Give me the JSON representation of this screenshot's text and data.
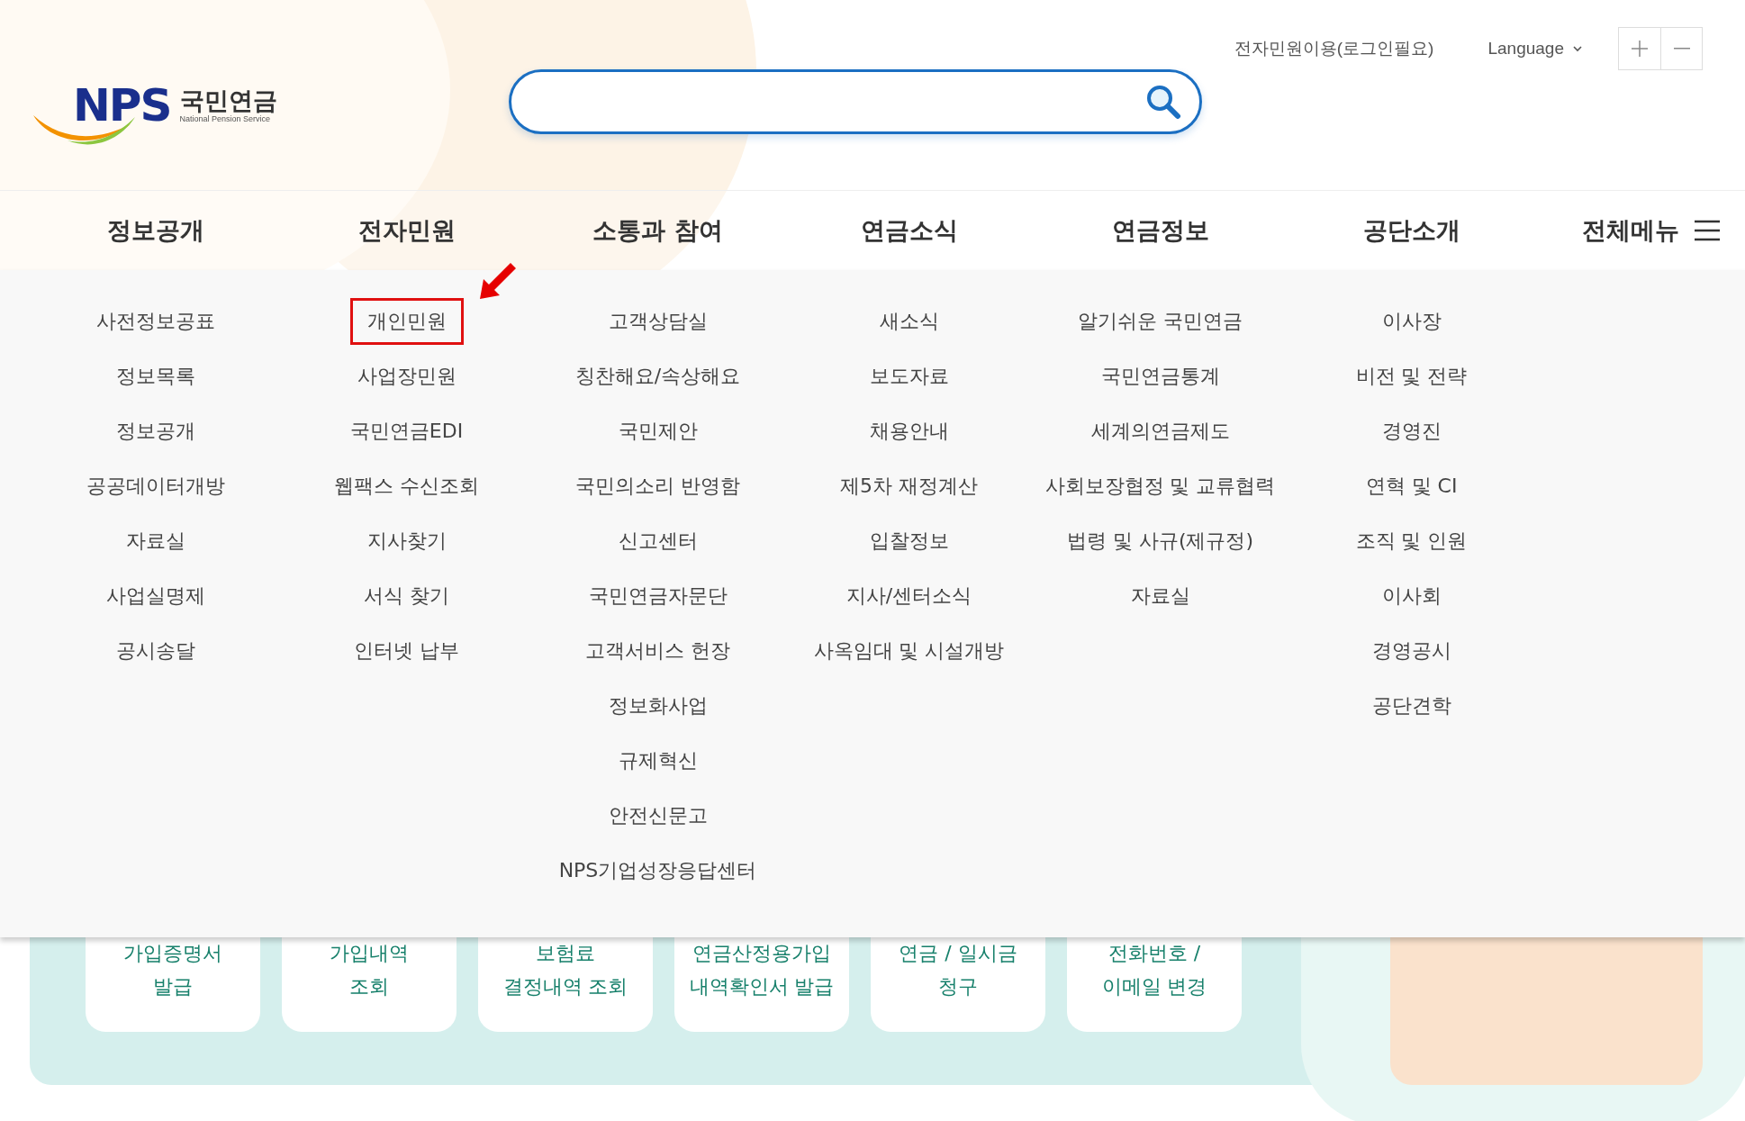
{
  "header": {
    "logo": {
      "mark": "NPS",
      "name": "국민연금",
      "subtitle": "National Pension Service"
    },
    "login_link": "전자민원이용(로그인필요)",
    "language": "Language"
  },
  "nav": {
    "items": [
      "정보공개",
      "전자민원",
      "소통과 참여",
      "연금소식",
      "연금정보",
      "공단소개"
    ],
    "all_menu": "전체메뉴"
  },
  "mega_menu": [
    [
      {
        "label": "사전정보공표",
        "highlighted": false
      },
      {
        "label": "정보목록",
        "highlighted": false
      },
      {
        "label": "정보공개",
        "highlighted": false
      },
      {
        "label": "공공데이터개방",
        "highlighted": false
      },
      {
        "label": "자료실",
        "highlighted": false
      },
      {
        "label": "사업실명제",
        "highlighted": false
      },
      {
        "label": "공시송달",
        "highlighted": false
      }
    ],
    [
      {
        "label": "개인민원",
        "highlighted": true
      },
      {
        "label": "사업장민원",
        "highlighted": false
      },
      {
        "label": "국민연금EDI",
        "highlighted": false
      },
      {
        "label": "웹팩스 수신조회",
        "highlighted": false
      },
      {
        "label": "지사찾기",
        "highlighted": false
      },
      {
        "label": "서식 찾기",
        "highlighted": false
      },
      {
        "label": "인터넷 납부",
        "highlighted": false
      }
    ],
    [
      {
        "label": "고객상담실",
        "highlighted": false
      },
      {
        "label": "칭찬해요/속상해요",
        "highlighted": false
      },
      {
        "label": "국민제안",
        "highlighted": false
      },
      {
        "label": "국민의소리 반영함",
        "highlighted": false
      },
      {
        "label": "신고센터",
        "highlighted": false
      },
      {
        "label": "국민연금자문단",
        "highlighted": false
      },
      {
        "label": "고객서비스 헌장",
        "highlighted": false
      },
      {
        "label": "정보화사업",
        "highlighted": false
      },
      {
        "label": "규제혁신",
        "highlighted": false
      },
      {
        "label": "안전신문고",
        "highlighted": false
      },
      {
        "label": "NPS기업성장응답센터",
        "highlighted": false
      }
    ],
    [
      {
        "label": "새소식",
        "highlighted": false
      },
      {
        "label": "보도자료",
        "highlighted": false
      },
      {
        "label": "채용안내",
        "highlighted": false
      },
      {
        "label": "제5차 재정계산",
        "highlighted": false
      },
      {
        "label": "입찰정보",
        "highlighted": false
      },
      {
        "label": "지사/센터소식",
        "highlighted": false
      },
      {
        "label": "사옥임대 및 시설개방",
        "highlighted": false
      }
    ],
    [
      {
        "label": "알기쉬운 국민연금",
        "highlighted": false
      },
      {
        "label": "국민연금통계",
        "highlighted": false
      },
      {
        "label": "세계의연금제도",
        "highlighted": false
      },
      {
        "label": "사회보장협정 및 교류협력",
        "highlighted": false
      },
      {
        "label": "법령 및 사규(제규정)",
        "highlighted": false
      },
      {
        "label": "자료실",
        "highlighted": false
      }
    ],
    [
      {
        "label": "이사장",
        "highlighted": false
      },
      {
        "label": "비전 및 전략",
        "highlighted": false
      },
      {
        "label": "경영진",
        "highlighted": false
      },
      {
        "label": "연혁 및 CI",
        "highlighted": false
      },
      {
        "label": "조직 및 인원",
        "highlighted": false
      },
      {
        "label": "이사회",
        "highlighted": false
      },
      {
        "label": "경영공시",
        "highlighted": false
      },
      {
        "label": "공단견학",
        "highlighted": false
      }
    ]
  ],
  "quick_services": [
    {
      "lines": [
        "가입증명서",
        "발급"
      ]
    },
    {
      "lines": [
        "가입내역",
        "조회"
      ]
    },
    {
      "lines": [
        "보험료",
        "결정내역 조회"
      ]
    },
    {
      "lines": [
        "연금산정용가입",
        "내역확인서 발급"
      ]
    },
    {
      "lines": [
        "연금 / 일시금",
        "청구"
      ]
    },
    {
      "lines": [
        "전화번호 /",
        "이메일 변경"
      ]
    }
  ]
}
